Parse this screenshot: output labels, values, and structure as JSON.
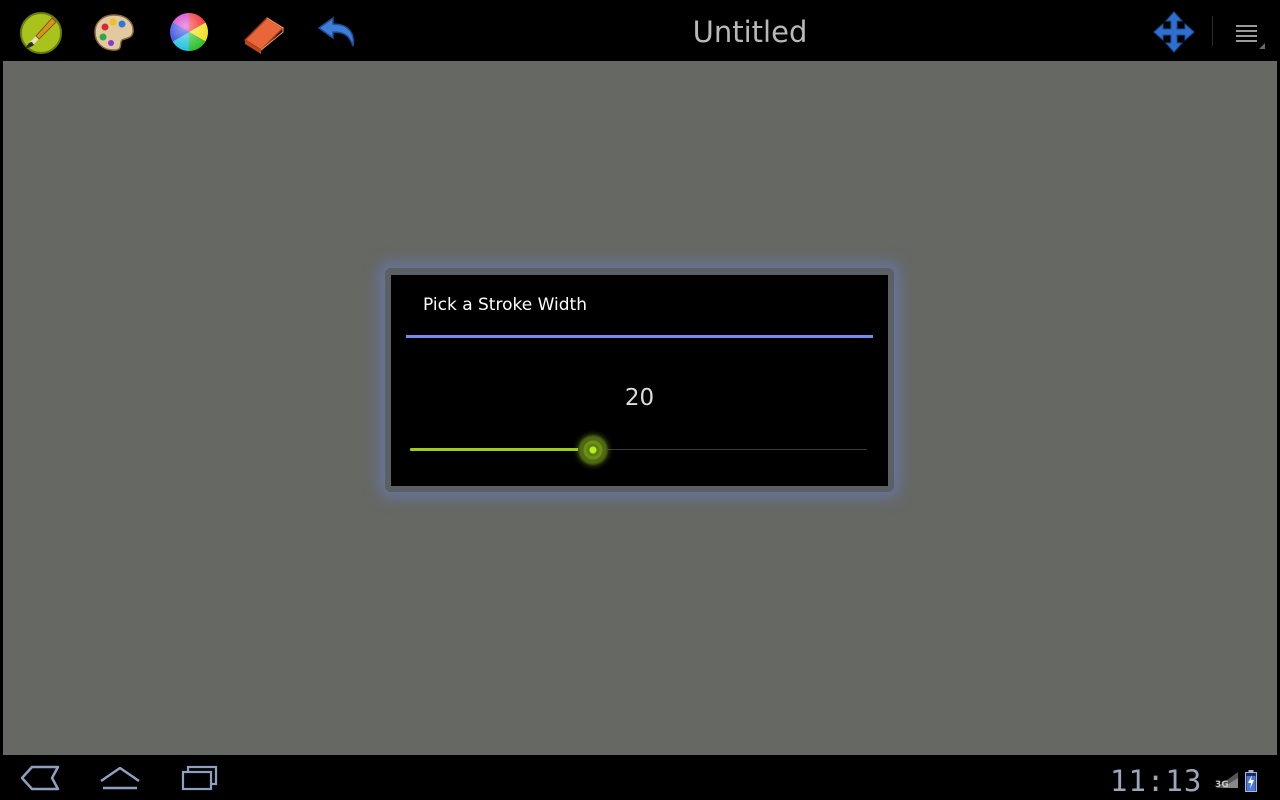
{
  "app": {
    "title": "Untitled"
  },
  "toolbar": {
    "tools": [
      {
        "name": "brush-tool-button",
        "icon": "brush-icon"
      },
      {
        "name": "palette-tool-button",
        "icon": "palette-icon"
      },
      {
        "name": "color-wheel-button",
        "icon": "color-wheel-icon"
      },
      {
        "name": "eraser-tool-button",
        "icon": "eraser-icon"
      },
      {
        "name": "undo-button",
        "icon": "undo-icon"
      }
    ],
    "move_icon": "move-arrows-icon",
    "overflow_icon": "overflow-menu-icon"
  },
  "canvas": {
    "color": "#666864"
  },
  "dialog": {
    "title": "Pick a Stroke Width",
    "value": "20",
    "slider_fraction": 0.4,
    "accent_color": "#6f8ef0",
    "slider_color": "#9ccd1c"
  },
  "system_bar": {
    "buttons": [
      "back-icon",
      "home-icon",
      "recent-apps-icon"
    ],
    "clock": "11:13",
    "network": "3G",
    "battery_icon": "battery-charging-icon"
  }
}
